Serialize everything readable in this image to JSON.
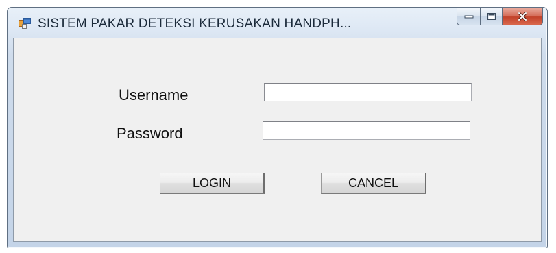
{
  "window": {
    "title": "SISTEM PAKAR DETEKSI KERUSAKAN HANDPH...",
    "controls": [
      "minimize",
      "maximize",
      "close"
    ],
    "colors": {
      "client_bg": "#f0f0f0",
      "close_button": "#c2422a"
    }
  },
  "form": {
    "username_label": "Username",
    "username_value": "",
    "password_label": "Password",
    "password_value": "",
    "login_button": "LOGIN",
    "cancel_button": "CANCEL"
  }
}
